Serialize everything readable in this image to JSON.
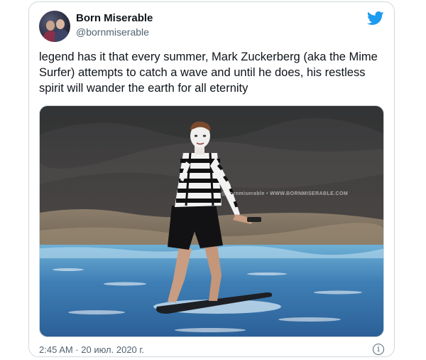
{
  "tweet": {
    "author_name": "Born Miserable",
    "author_handle": "@bornmiserable",
    "text": "legend has it that every summer, Mark Zuckerberg (aka the Mime Surfer) attempts to catch a wave and until he does, his restless spirit will wander the earth for all eternity",
    "timestamp": "2:45 AM · 20 июл. 2020 г.",
    "photo_watermark": "@bornmiserable • WWW.BORNMISERABLE.COM"
  },
  "icons": {
    "brand": "twitter-bird-icon",
    "info": "info-icon",
    "avatar": "avatar"
  },
  "colors": {
    "twitter_blue": "#1d9bf0",
    "text_primary": "#0f1419",
    "text_secondary": "#536471",
    "border": "#cfd9de"
  }
}
